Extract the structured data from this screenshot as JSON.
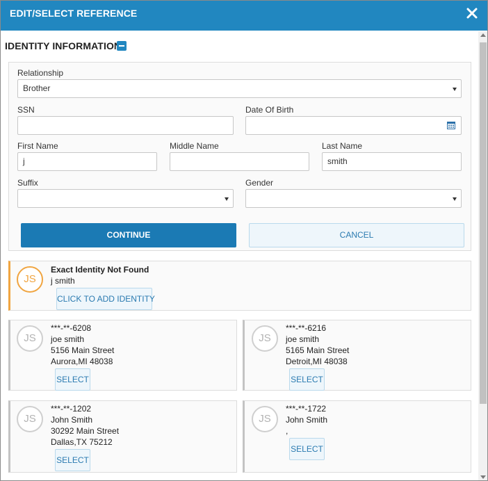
{
  "dialog": {
    "title": "EDIT/SELECT REFERENCE"
  },
  "identity": {
    "section_title": "IDENTITY INFORMATION",
    "relationship": {
      "label": "Relationship",
      "value": "Brother"
    },
    "ssn": {
      "label": "SSN",
      "value": ""
    },
    "dob": {
      "label": "Date Of Birth",
      "value": ""
    },
    "first_name": {
      "label": "First Name",
      "value": "j"
    },
    "middle_name": {
      "label": "Middle Name",
      "value": ""
    },
    "last_name": {
      "label": "Last Name",
      "value": "smith"
    },
    "suffix": {
      "label": "Suffix",
      "value": ""
    },
    "gender": {
      "label": "Gender",
      "value": ""
    },
    "continue_label": "CONTINUE",
    "cancel_label": "CANCEL"
  },
  "not_found": {
    "initials": "JS",
    "heading": "Exact Identity Not Found",
    "name": "j smith",
    "button_label": "CLICK TO ADD IDENTITY"
  },
  "results": [
    {
      "initials": "JS",
      "ssn": "***-**-6208",
      "name": "joe smith",
      "street": "5156 Main Street",
      "city": "Aurora,MI 48038",
      "button_label": "SELECT"
    },
    {
      "initials": "JS",
      "ssn": "***-**-6216",
      "name": "joe smith",
      "street": "5165 Main Street",
      "city": "Detroit,MI 48038",
      "button_label": "SELECT"
    },
    {
      "initials": "JS",
      "ssn": "***-**-1202",
      "name": "John Smith",
      "street": "30292 Main Street",
      "city": "Dallas,TX 75212",
      "button_label": "SELECT"
    },
    {
      "initials": "JS",
      "ssn": "***-**-1722",
      "name": "John Smith",
      "street": ",",
      "button_label": "SELECT"
    }
  ],
  "colors": {
    "header_blue": "#2187c0",
    "primary_button": "#1b7ab4",
    "accent_orange": "#f0a541"
  },
  "icons": [
    "close-icon",
    "collapse-minus-icon",
    "calendar-icon",
    "dropdown-caret-icon"
  ]
}
